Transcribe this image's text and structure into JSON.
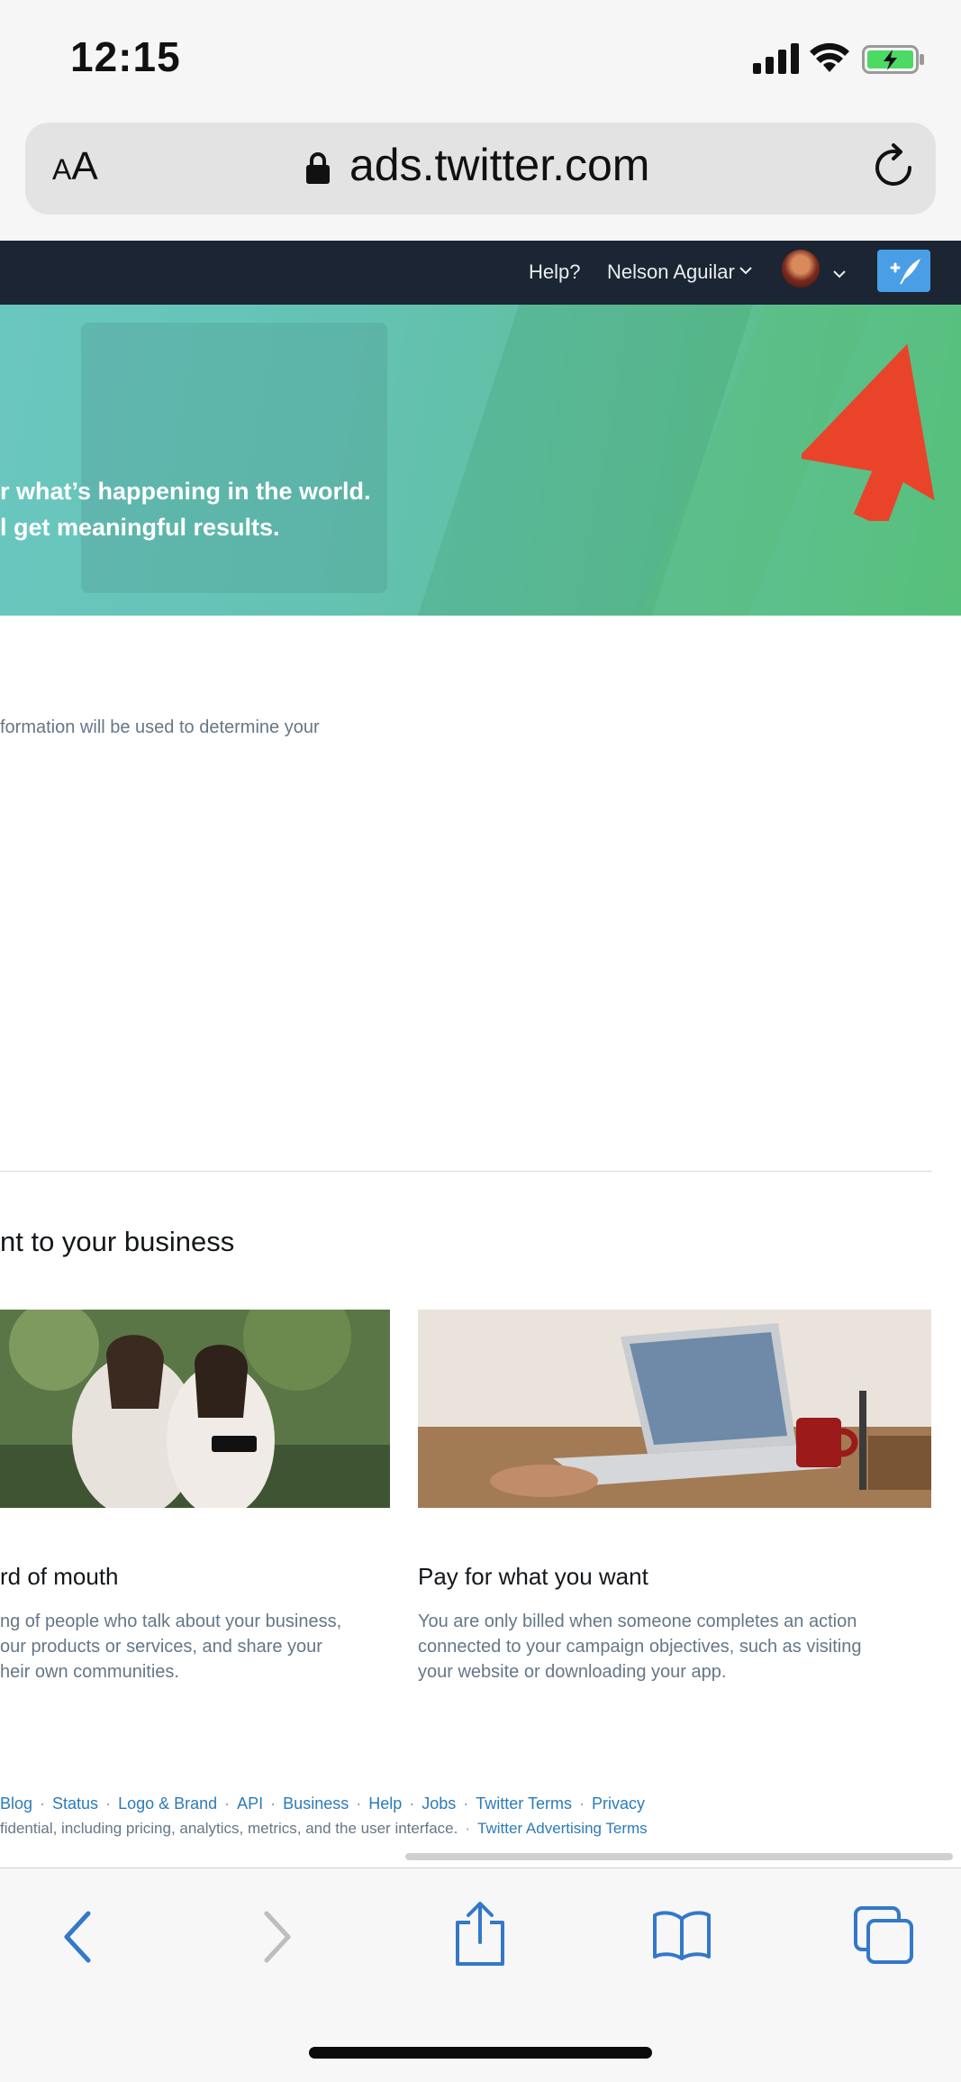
{
  "status_bar": {
    "time": "12:15"
  },
  "address_bar": {
    "text_size_label_small": "A",
    "text_size_label_large": "A",
    "url": "ads.twitter.com"
  },
  "nav": {
    "help": "Help?",
    "user_name": "Nelson Aguilar"
  },
  "hero": {
    "line1": "r what’s happening in the world.",
    "line2": "l get meaningful results."
  },
  "main": {
    "info_text": "formation will be used to determine your",
    "section_title": "nt to your business",
    "cards": [
      {
        "title": "rd of mouth",
        "desc": [
          "ng of people who talk about your business,",
          "our products or services, and share your",
          "heir own communities."
        ]
      },
      {
        "title": "Pay for what you want",
        "desc": [
          "You are only billed when someone completes an action",
          "connected to your campaign objectives, such as visiting",
          "your website or downloading your app."
        ]
      }
    ]
  },
  "footer": {
    "links": [
      "Blog",
      "Status",
      "Logo & Brand",
      "API",
      "Business",
      "Help",
      "Jobs",
      "Twitter Terms",
      "Privacy"
    ],
    "legal_text": "fidential, including pricing, analytics, metrics, and the user interface.",
    "advertising_terms": "Twitter Advertising Terms"
  },
  "toolbar": {
    "icons": [
      "back-icon",
      "forward-icon",
      "share-icon",
      "bookmarks-icon",
      "tabs-icon"
    ]
  },
  "colors": {
    "nav_bg": "#1c2533",
    "compose_bg": "#4a9ee6",
    "link": "#2b7bb9",
    "arrow": "#e9442a",
    "toolbar_icon": "#3478c9"
  }
}
